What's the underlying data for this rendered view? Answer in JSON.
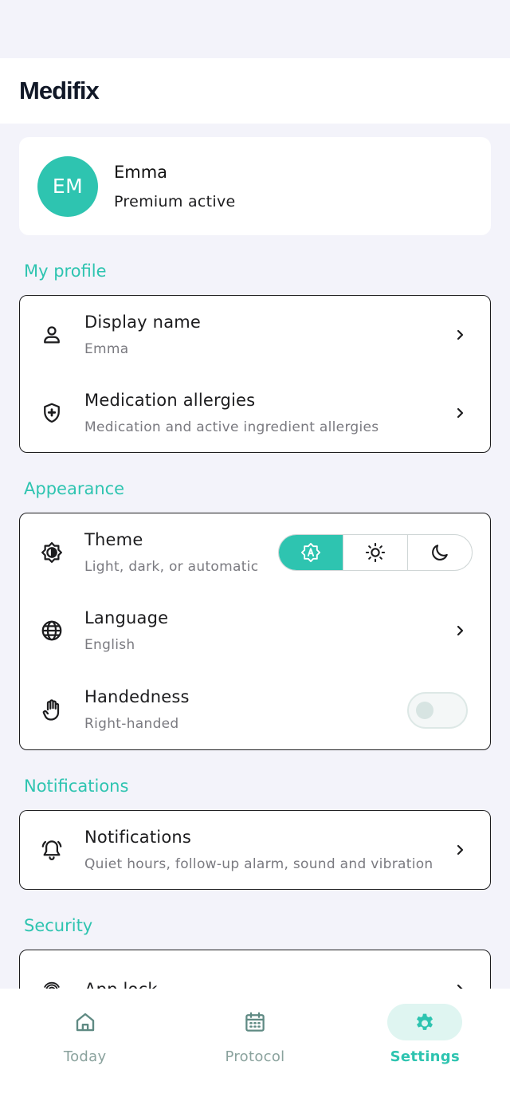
{
  "app": {
    "title": "Medifix"
  },
  "profile": {
    "initials": "EM",
    "name": "Emma",
    "status": "Premium active"
  },
  "colors": {
    "accent": "#2ec4b0",
    "text": "#1c1c1e",
    "muted": "#7a7a80",
    "background": "#f3f3fa"
  },
  "sections": {
    "my_profile": {
      "title": "My profile",
      "items": [
        {
          "icon": "person-icon",
          "label": "Display name",
          "sub": "Emma"
        },
        {
          "icon": "shield-plus-icon",
          "label": "Medication allergies",
          "sub": "Medication and active ingredient allergies"
        }
      ]
    },
    "appearance": {
      "title": "Appearance",
      "theme": {
        "label": "Theme",
        "sub": "Light, dark, or automatic",
        "options": [
          "auto-theme-icon",
          "sun-icon",
          "moon-icon"
        ],
        "selected": "auto"
      },
      "language": {
        "label": "Language",
        "sub": "English"
      },
      "handedness": {
        "label": "Handedness",
        "sub": "Right-handed",
        "toggle_on": false
      }
    },
    "notifications": {
      "title": "Notifications",
      "items": [
        {
          "icon": "bell-ring-icon",
          "label": "Notifications",
          "sub": "Quiet hours, follow-up alarm, sound and vibration"
        }
      ]
    },
    "security": {
      "title": "Security",
      "items": [
        {
          "icon": "fingerprint-icon",
          "label": "App lock"
        }
      ]
    }
  },
  "nav": {
    "items": [
      {
        "icon": "home-icon",
        "label": "Today"
      },
      {
        "icon": "calendar-icon",
        "label": "Protocol"
      },
      {
        "icon": "gear-icon",
        "label": "Settings"
      }
    ],
    "active": "Settings"
  }
}
